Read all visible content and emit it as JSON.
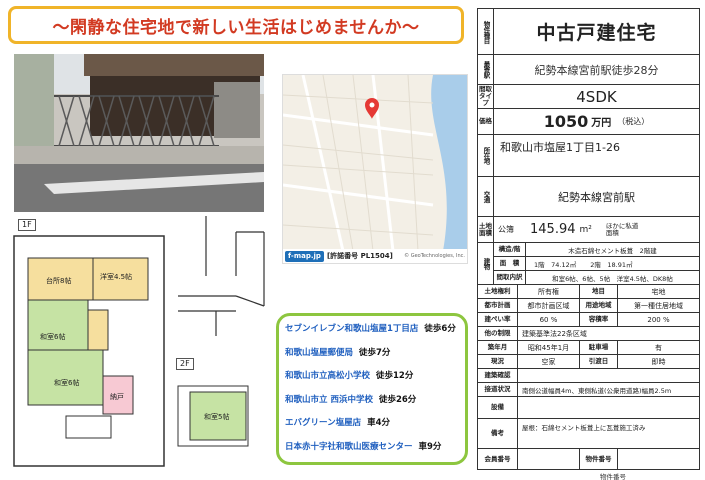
{
  "banner": "～閑静な住宅地で新しい生活はじめませんか～",
  "property": {
    "type_label": "物件種目",
    "type": "中古戸建住宅",
    "access_label": "最寄駅",
    "access": "紀勢本線宮前駅徒歩28分",
    "layout_label": "間取タイプ",
    "layout": "4SDK",
    "price_label": "価格",
    "price": "1050",
    "price_unit": "万円",
    "price_tax": "（税込）",
    "address_label": "所在地",
    "address": "和歌山市塩屋1丁目1-26",
    "transport_label": "交通",
    "transport": "紀勢本線宮前駅",
    "land_label": "土地面積",
    "land_type": "公簿",
    "land_area": "145.94",
    "land_unit": "m²",
    "private_road": "ほかに私道面積",
    "building_label": "建物",
    "structure_label": "構造/階",
    "structure": "木造石綿セメント板葺　2階建",
    "floor_area_label": "面　積",
    "floor_area_1f": "1階　74.12㎡",
    "floor_area_2f": "2階　18.91㎡",
    "rooms_label": "間取内訳",
    "rooms": "和室6帖、6帖、5帖　洋室4.5帖、DK8帖",
    "land_right_label": "土地権利",
    "land_right": "所有権",
    "land_category_label": "地目",
    "land_category": "宅地",
    "city_plan_label": "都市計画",
    "city_plan": "都市計画区域",
    "zoning_label": "用途地域",
    "zoning": "第一種住居地域",
    "coverage_label": "建ぺい率",
    "coverage": "60 %",
    "far_label": "容積率",
    "far": "200 %",
    "restrictions_label": "他の制限",
    "restrictions": "建築基準法22条区域",
    "built_label": "築年月",
    "built": "昭和45年1月",
    "parking_label": "駐車場",
    "parking": "有",
    "status_label": "現況",
    "status": "空家",
    "handover_label": "引渡日",
    "handover": "即時",
    "building_cert_label": "建築確認",
    "building_cert": "",
    "road_label": "接道状況",
    "road": "南側公道幅員4m、東側私道(公衆用道路)幅員2.5m",
    "facilities_label": "設備",
    "facilities": "",
    "remarks_label": "備考",
    "remarks": "屋根：石綿セメント板葺上に瓦葺施工済み",
    "member_label": "会員番号",
    "member": "",
    "listing_label": "物件番号",
    "listing": "",
    "bottom_note": "物件番号"
  },
  "map": {
    "brand": "f-map.jp",
    "license": "[許諾番号 PL1504]",
    "copyright": "© GeoTechnologies, Inc."
  },
  "floorplan": {
    "floor1": "1F",
    "floor2": "2F",
    "rooms": [
      "台所8帖",
      "洋室4.5帖",
      "和室6帖",
      "和室6帖",
      "納戸",
      "和室5帖"
    ]
  },
  "nearby": [
    {
      "name": "セブンイレブン和歌山塩屋1丁目店",
      "walk": "徒歩6分"
    },
    {
      "name": "和歌山塩屋郵便局",
      "walk": "徒歩7分"
    },
    {
      "name": "和歌山市立高松小学校",
      "walk": "徒歩12分"
    },
    {
      "name": "和歌山市立 西浜中学校",
      "walk": "徒歩26分"
    },
    {
      "name": "エバグリーン塩屋店",
      "walk": "車4分"
    },
    {
      "name": "日本赤十字社和歌山医療センター",
      "walk": "車9分"
    }
  ],
  "colors": {
    "banner_border": "#f0b429",
    "banner_text": "#d23a22",
    "nearby_border": "#8dc63f",
    "nearby_text": "#1f5fbf",
    "map_pin": "#e53935"
  }
}
